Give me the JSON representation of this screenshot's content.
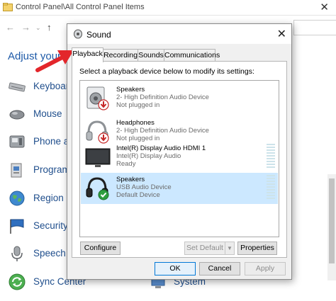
{
  "control_panel": {
    "title": "Control Panel\\All Control Panel Items",
    "close_glyph": "✕",
    "heading": "Adjust your",
    "items": [
      {
        "label": "Keyboard",
        "icon": "keyboard-icon"
      },
      {
        "label": "Mouse",
        "icon": "mouse-icon"
      },
      {
        "label": "Phone ar",
        "icon": "phone-icon"
      },
      {
        "label": "Program",
        "icon": "programs-icon"
      },
      {
        "label": "Region",
        "icon": "region-globe-icon"
      },
      {
        "label": "Security",
        "icon": "security-flag-icon"
      },
      {
        "label": "Speech R",
        "icon": "microphone-icon"
      },
      {
        "label": "Sync Center",
        "icon": "sync-icon"
      }
    ],
    "right_item": {
      "label": "System",
      "icon": "system-icon"
    }
  },
  "dialog": {
    "title": "Sound",
    "close_glyph": "✕",
    "tabs": [
      "Playback",
      "Recording",
      "Sounds",
      "Communications"
    ],
    "active_tab": "Playback",
    "instruction": "Select a playback device below to modify its settings:",
    "devices": [
      {
        "name": "Speakers",
        "line2": "2- High Definition Audio Device",
        "status": "Not plugged in",
        "icon": "speaker-unplugged-icon",
        "selected": false
      },
      {
        "name": "Headphones",
        "line2": "2- High Definition Audio Device",
        "status": "Not plugged in",
        "icon": "headphones-unplugged-icon",
        "selected": false
      },
      {
        "name": "Intel(R) Display Audio HDMI 1",
        "line2": "Intel(R) Display Audio",
        "status": "Ready",
        "icon": "monitor-icon",
        "selected": false
      },
      {
        "name": "Speakers",
        "line2": "USB Audio Device",
        "status": "Default Device",
        "icon": "headphones-default-icon",
        "selected": true
      }
    ],
    "buttons": {
      "configure": "Configure",
      "set_default": "Set Default",
      "set_default_arrow": "▼",
      "properties": "Properties",
      "ok": "OK",
      "cancel": "Cancel",
      "apply": "Apply"
    }
  },
  "colors": {
    "link_blue": "#1f4e8c",
    "selection": "#cce8ff",
    "arrow_red": "#e3262b",
    "accent": "#0078d7"
  }
}
